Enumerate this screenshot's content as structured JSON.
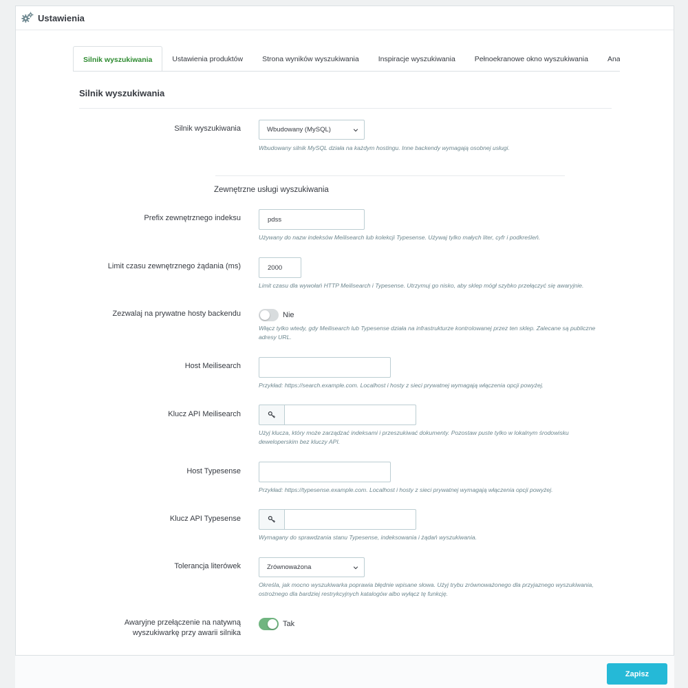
{
  "header": {
    "title": "Ustawienia",
    "icon": "gears-icon"
  },
  "tabs": [
    {
      "label": "Silnik wyszukiwania",
      "active": true
    },
    {
      "label": "Ustawienia produktów",
      "active": false
    },
    {
      "label": "Strona wyników wyszukiwania",
      "active": false
    },
    {
      "label": "Inspiracje wyszukiwania",
      "active": false
    },
    {
      "label": "Pełnoekranowe okno wyszukiwania",
      "active": false
    },
    {
      "label": "Analityka i",
      "active": false
    }
  ],
  "section": {
    "title": "Silnik wyszukiwania",
    "subtitle": "Zewnętrzne usługi wyszukiwania"
  },
  "fields": {
    "engine": {
      "label": "Silnik wyszukiwania",
      "value": "Wbudowany (MySQL)",
      "help": "Wbudowany silnik MySQL działa na każdym hostingu. Inne backendy wymagają osobnej usługi."
    },
    "prefix": {
      "label": "Prefix zewnętrznego indeksu",
      "value": "pdss",
      "help": "Używany do nazw indeksów Meilisearch lub kolekcji Typesense. Używaj tylko małych liter, cyfr i podkreśleń."
    },
    "timeout": {
      "label": "Limit czasu zewnętrznego żądania (ms)",
      "value": "2000",
      "help": "Limit czasu dla wywołań HTTP Meilisearch i Typesense. Utrzymuj go nisko, aby sklep mógł szybko przełączyć się awaryjnie."
    },
    "private_hosts": {
      "label": "Zezwalaj na prywatne hosty backendu",
      "state_text": "Nie",
      "enabled": false,
      "help": "Włącz tylko wtedy, gdy Meilisearch lub Typesense działa na infrastrukturze kontrolowanej przez ten sklep. Zalecane są publiczne adresy URL."
    },
    "meili_host": {
      "label": "Host Meilisearch",
      "value": "",
      "help": "Przykład: https://search.example.com. Localhost i hosty z sieci prywatnej wymagają włączenia opcji powyżej."
    },
    "meili_key": {
      "label": "Klucz API Meilisearch",
      "value": "",
      "icon": "key-icon",
      "help": "Użyj klucza, który może zarządzać indeksami i przeszukiwać dokumenty. Pozostaw puste tylko w lokalnym środowisku deweloperskim bez kluczy API."
    },
    "typesense_host": {
      "label": "Host Typesense",
      "value": "",
      "help": "Przykład: https://typesense.example.com. Localhost i hosty z sieci prywatnej wymagają włączenia opcji powyżej."
    },
    "typesense_key": {
      "label": "Klucz API Typesense",
      "value": "",
      "icon": "key-icon",
      "help": "Wymagany do sprawdzania stanu Typesense, indeksowania i żądań wyszukiwania."
    },
    "typo": {
      "label": "Tolerancja literówek",
      "value": "Zrównoważona",
      "help": "Określa, jak mocno wyszukiwarka poprawia błędnie wpisane słowa. Użyj trybu zrównoważonego dla przyjaznego wyszukiwania, ostrożnego dla bardziej restrykcyjnych katalogów albo wyłącz tę funkcję."
    },
    "fallback": {
      "label": "Awaryjne przełączenie na natywną wyszukiwarkę przy awarii silnika",
      "state_text": "Tak",
      "enabled": true
    }
  },
  "footer": {
    "save_label": "Zapisz"
  },
  "colors": {
    "accent": "#25b9d7",
    "active_tab": "#2e8b30",
    "switch_on": "#70b580",
    "switch_off": "#d8dcde",
    "help_text": "#6c868e"
  }
}
